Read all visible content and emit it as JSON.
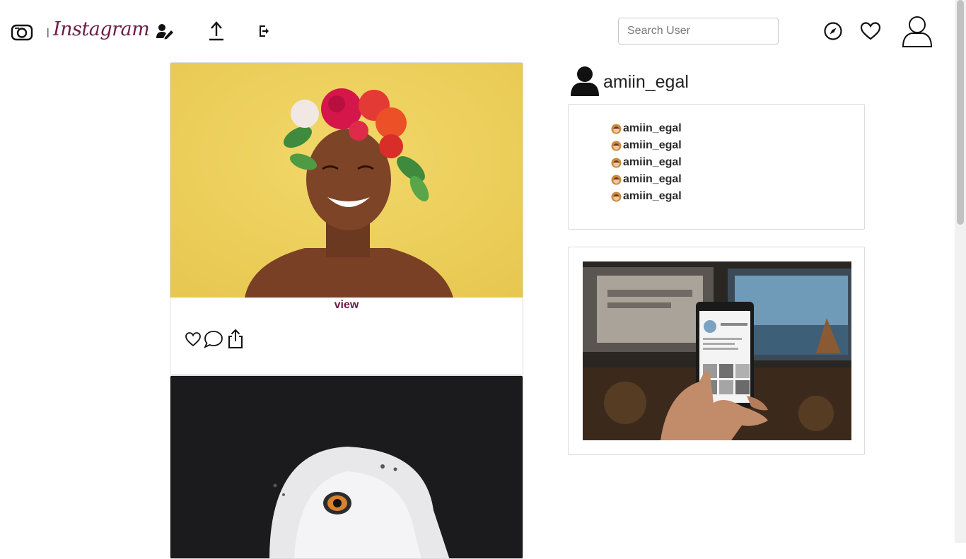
{
  "header": {
    "brand_name": "Instagram",
    "separator": "|",
    "search_placeholder": "Search User",
    "icons": [
      "instagram-camera-icon",
      "edit-profile-icon",
      "upload-icon",
      "logout-icon",
      "explore-compass-icon",
      "heart-icon",
      "user-profile-icon"
    ]
  },
  "feed": {
    "posts": [
      {
        "view_label": "view",
        "image": "woman-with-flower-crown",
        "actions": [
          "like-icon",
          "comment-icon",
          "share-icon"
        ]
      },
      {
        "image": "snowy-owl"
      }
    ]
  },
  "sidebar": {
    "profile_name": "amiin_egal",
    "suggestions": [
      {
        "username": "amiin_egal"
      },
      {
        "username": "amiin_egal"
      },
      {
        "username": "amiin_egal"
      },
      {
        "username": "amiin_egal"
      },
      {
        "username": "amiin_egal"
      }
    ],
    "ad_image": "hand-holding-phone-instagram"
  },
  "colors": {
    "brand": "#6d1b47",
    "border": "#dcdcdc",
    "scrollbar_thumb": "#c1c1c1"
  }
}
